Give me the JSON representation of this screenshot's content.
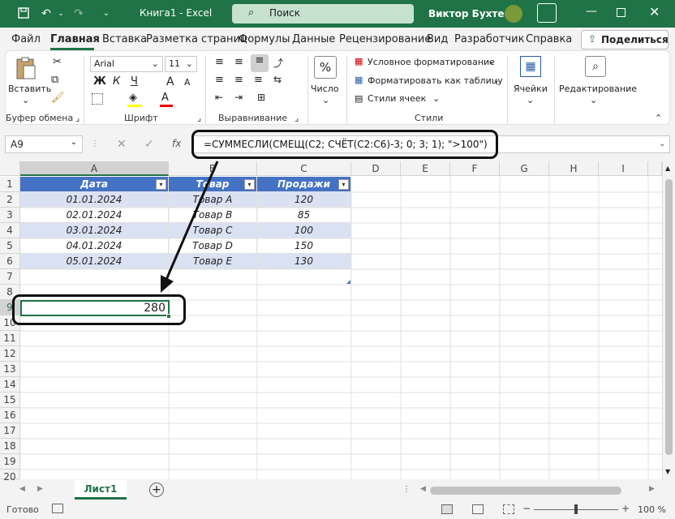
{
  "titlebar": {
    "autosave_icon": "save-icon",
    "undo_icon": "undo-icon",
    "redo_icon": "redo-icon",
    "doc_title": "Книга1  -  Excel",
    "search_placeholder": "Поиск",
    "user": "Виктор Бухтеев"
  },
  "ribbon_tabs": [
    "Файл",
    "Главная",
    "Вставка",
    "Разметка страниц",
    "Формулы",
    "Данные",
    "Рецензирование",
    "Вид",
    "Разработчик",
    "Справка"
  ],
  "share_label": "Поделиться",
  "groups": {
    "clipboard": {
      "label": "Буфер обмена",
      "paste": "Вставить"
    },
    "font": {
      "label": "Шрифт",
      "name": "Arial",
      "size": "11",
      "bold": "Ж",
      "italic": "К",
      "underline": "Ч",
      "grow": "A",
      "shrink": "A"
    },
    "alignment": {
      "label": "Выравнивание"
    },
    "number": {
      "label": "Число",
      "icon_text": "%"
    },
    "styles": {
      "label": "Стили",
      "cond": "Условное форматирование",
      "table": "Форматировать как таблицу",
      "cell": "Стили ячеек"
    },
    "cells": {
      "label": "Ячейки"
    },
    "editing": {
      "label": "Редактирование"
    }
  },
  "formula_bar": {
    "namebox": "A9",
    "fx": "fx",
    "formula": "=СУММЕСЛИ(СМЕЩ(C2; СЧЁТ(C2:C6)-3; 0; 3; 1); \">100\")"
  },
  "columns": [
    "A",
    "B",
    "C",
    "D",
    "E",
    "F",
    "G",
    "H",
    "I"
  ],
  "rows": [
    "1",
    "2",
    "3",
    "4",
    "5",
    "6",
    "7",
    "8",
    "9",
    "10",
    "11",
    "12",
    "13",
    "14",
    "15",
    "16",
    "17",
    "18",
    "19",
    "20"
  ],
  "table": {
    "headers": [
      "Дата",
      "Товар",
      "Продажи"
    ],
    "data": [
      [
        "01.01.2024",
        "Товар A",
        "120"
      ],
      [
        "02.01.2024",
        "Товар B",
        "85"
      ],
      [
        "03.01.2024",
        "Товар C",
        "100"
      ],
      [
        "04.01.2024",
        "Товар D",
        "150"
      ],
      [
        "05.01.2024",
        "Товар E",
        "130"
      ]
    ]
  },
  "result_cell": "280",
  "sheet_tab": "Лист1",
  "status": {
    "ready": "Готово",
    "zoom": "100 %"
  },
  "colors": {
    "excel_green": "#1f7346",
    "table_header": "#4472c4",
    "table_band": "#d9e1f2"
  }
}
